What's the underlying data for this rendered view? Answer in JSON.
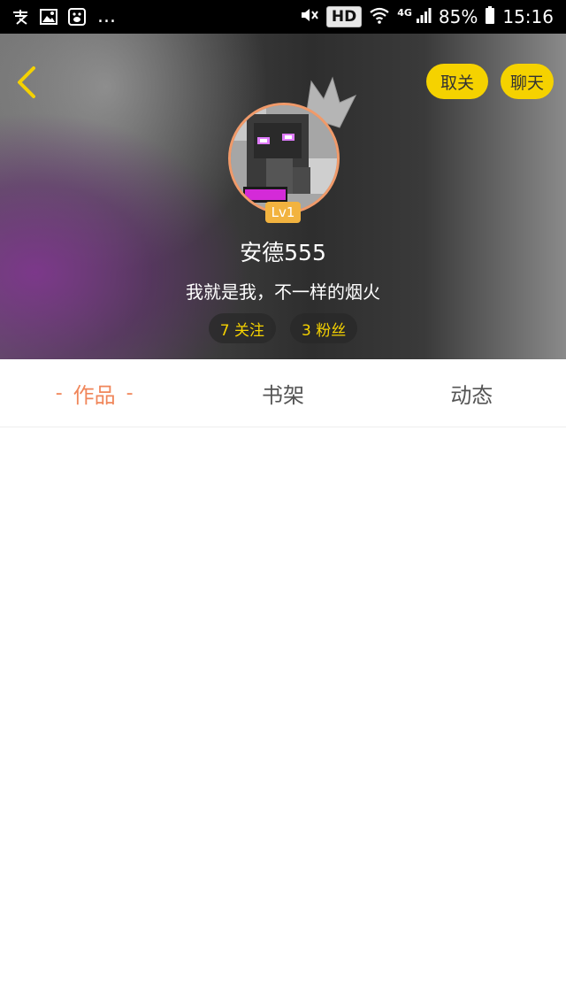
{
  "status_bar": {
    "notification_icons": [
      "alipay-icon",
      "image-icon",
      "baidu-icon"
    ],
    "more": "...",
    "hd": "HD",
    "network": "4G",
    "battery": "85%",
    "time": "15:16"
  },
  "header": {
    "back_icon": "chevron-left-icon",
    "unfollow_label": "取关",
    "chat_label": "聊天",
    "level": "Lv1",
    "username": "安德555",
    "bio": "我就是我，不一样的烟火",
    "following": "7 关注",
    "followers": "3 粉丝"
  },
  "tabs": [
    {
      "label": "作品",
      "active": true
    },
    {
      "label": "书架",
      "active": false
    },
    {
      "label": "动态",
      "active": false
    }
  ],
  "tab_active_decor": "-",
  "colors": {
    "accent_yellow": "#f5d200",
    "active_tab": "#f0865a",
    "level_badge": "#f2b33f",
    "avatar_border": "#f09a6a"
  }
}
